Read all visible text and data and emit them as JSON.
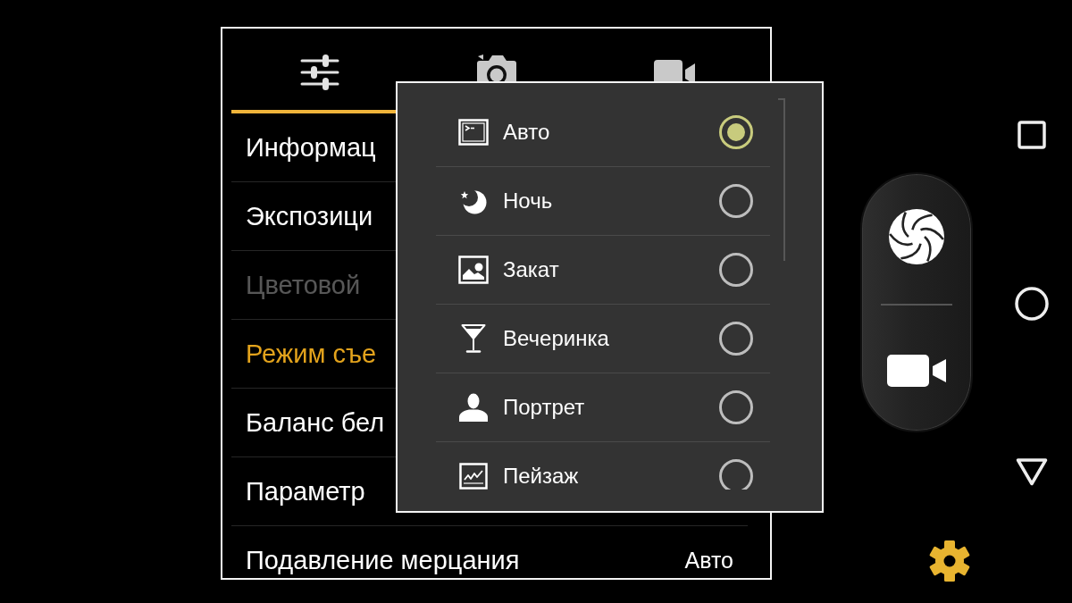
{
  "settings_panel": {
    "tabs": [
      {
        "selected": true
      },
      {
        "selected": false
      },
      {
        "selected": false
      }
    ],
    "rows": [
      {
        "label": "Информац",
        "selected": false,
        "disabled": false
      },
      {
        "label": "Экспозици",
        "selected": false,
        "disabled": false
      },
      {
        "label": "Цветовой",
        "selected": false,
        "disabled": true
      },
      {
        "label": "Режим съе",
        "selected": true,
        "disabled": false
      },
      {
        "label": "Баланс бел",
        "selected": false,
        "disabled": false
      },
      {
        "label": "Параметр",
        "selected": false,
        "disabled": false
      },
      {
        "label": "Подавление мерцания",
        "value": "Авто",
        "selected": false,
        "disabled": false
      }
    ]
  },
  "scene_mode_popup": {
    "options": [
      {
        "label": "Авто",
        "selected": true
      },
      {
        "label": "Ночь",
        "selected": false
      },
      {
        "label": "Закат",
        "selected": false
      },
      {
        "label": "Вечеринка",
        "selected": false
      },
      {
        "label": "Портрет",
        "selected": false
      },
      {
        "label": "Пейзаж",
        "selected": false
      }
    ]
  }
}
